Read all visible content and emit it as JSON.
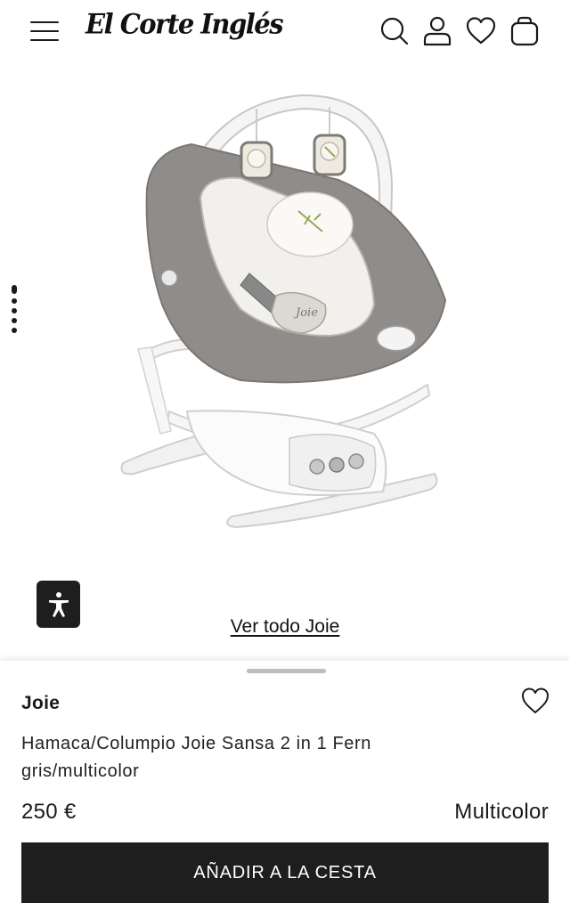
{
  "header": {
    "logo_text": "El Corte Inglés",
    "icons": [
      "menu-icon",
      "search-icon",
      "user-icon",
      "heart-icon",
      "bag-icon"
    ]
  },
  "product": {
    "image_alt": "Hamaca Joie Sansa 2 in 1 gris",
    "image_logo_text": "Joie",
    "see_all_label": "Ver todo Joie",
    "brand": "Joie",
    "title": "Hamaca/Columpio Joie Sansa 2 in 1 Fern gris/multicolor",
    "price": "250 €",
    "color": "Multicolor",
    "add_to_cart_label": "AÑADIR A LA CESTA"
  },
  "colors": {
    "primary": "#1e1e1e",
    "background": "#ffffff",
    "text": "#1a1a1a"
  }
}
